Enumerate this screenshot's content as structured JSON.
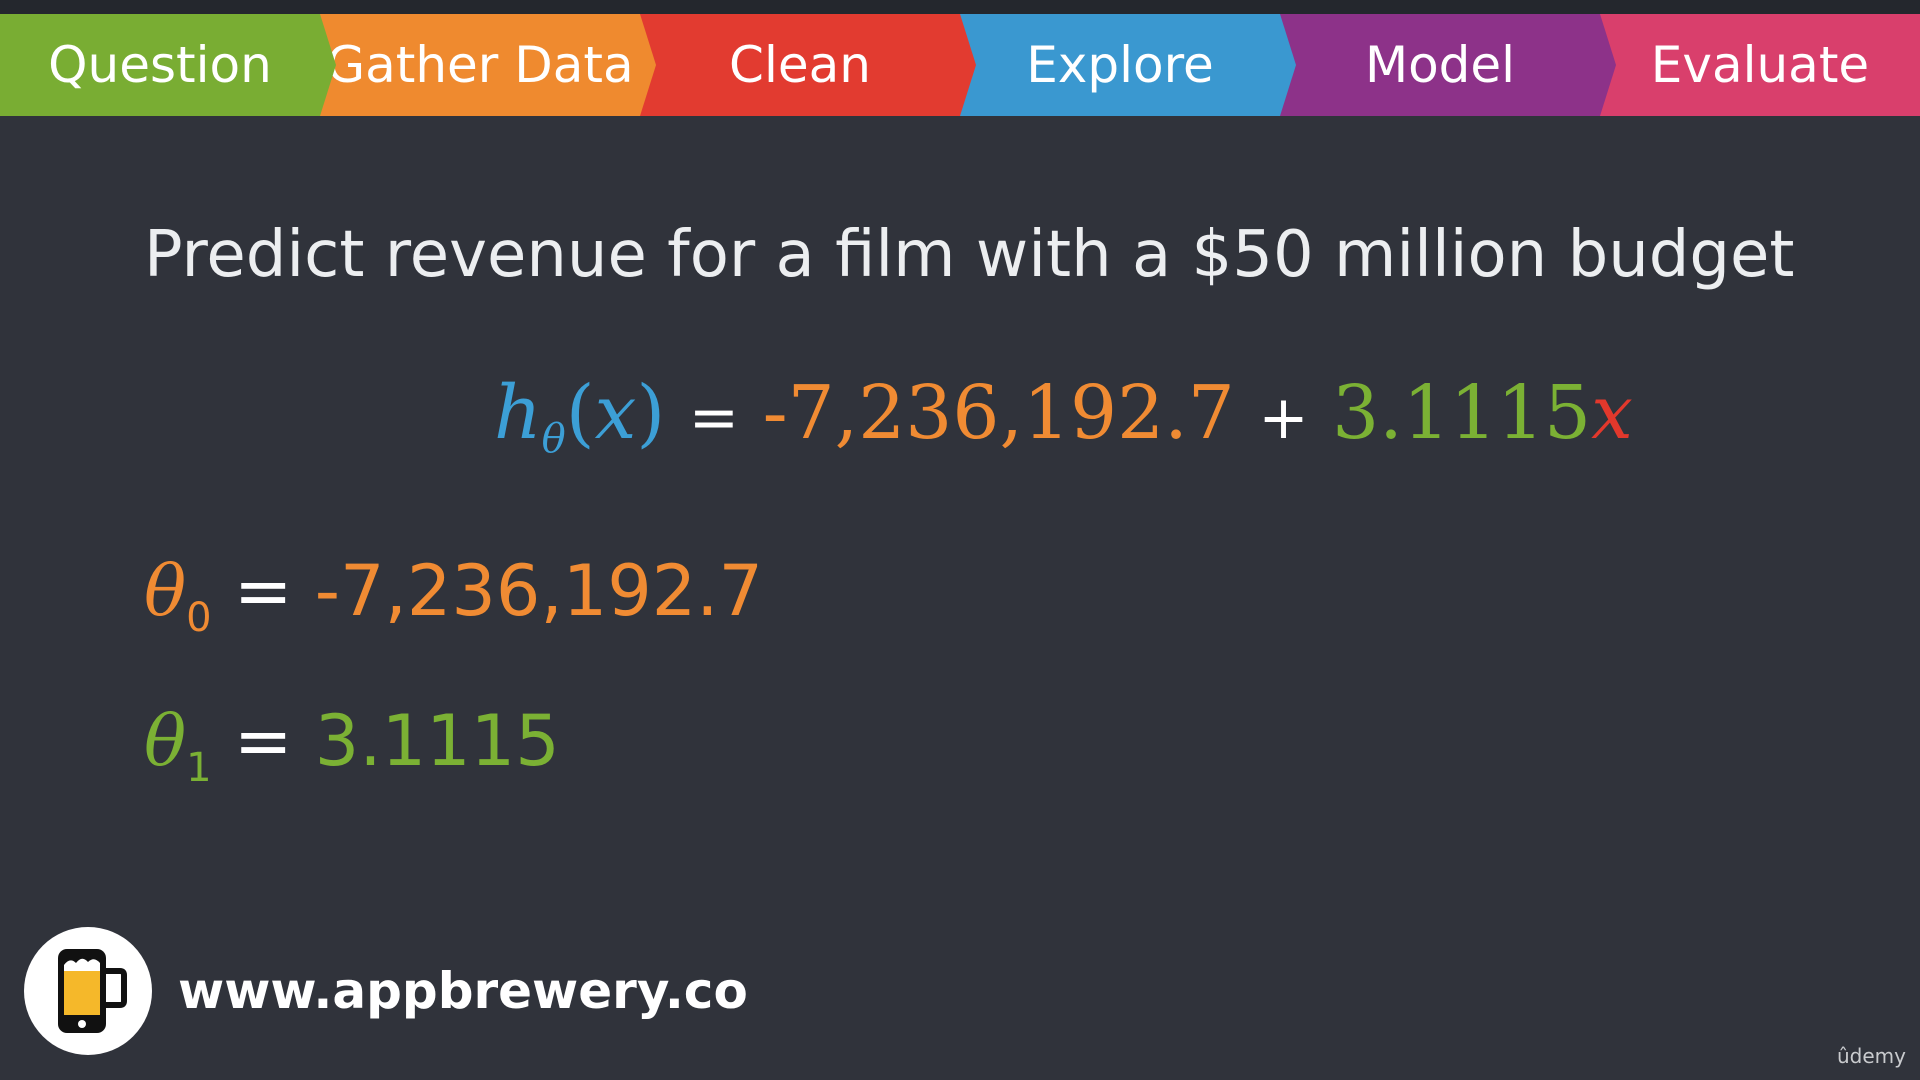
{
  "pipeline": {
    "steps": [
      {
        "label": "Question",
        "color": "#79ad33"
      },
      {
        "label": "Gather Data",
        "color": "#ef8a2f"
      },
      {
        "label": "Clean",
        "color": "#e23b30"
      },
      {
        "label": "Explore",
        "color": "#3a98d0"
      },
      {
        "label": "Model",
        "color": "#8d3289"
      },
      {
        "label": "Evaluate",
        "color": "#d93f6c"
      }
    ]
  },
  "headline": "Predict revenue for a film with a $50 million budget",
  "equation": {
    "fn": "h",
    "fn_sub": "θ",
    "open_paren": "(",
    "var": "x",
    "close_paren": ")",
    "equals": "=",
    "intercept": "-7,236,192.7",
    "plus": "+",
    "slope": "3.1115",
    "x": "x"
  },
  "theta0": {
    "symbol": "θ",
    "index": "0",
    "equals": "=",
    "value": "-7,236,192.7"
  },
  "theta1": {
    "symbol": "θ",
    "index": "1",
    "equals": "=",
    "value": "3.1115"
  },
  "footer": {
    "website": "www.appbrewery.co",
    "logo_icon": "beer-phone-icon",
    "watermark": "ûdemy"
  },
  "colors": {
    "background": "#30333b",
    "intercept": "#f08b33",
    "slope": "#7bb134",
    "hypothesis": "#3c9fd6",
    "x_var": "#e2382c"
  }
}
